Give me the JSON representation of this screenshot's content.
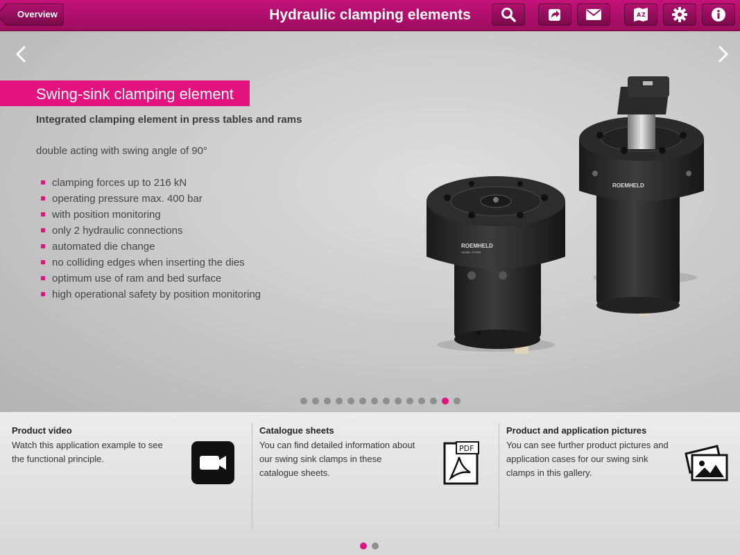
{
  "header": {
    "back_label": "Overview",
    "title": "Hydraulic clamping elements",
    "buttons": [
      "search-icon",
      "share-icon",
      "mail-icon",
      "language-icon",
      "gear-icon",
      "info-icon"
    ]
  },
  "slide": {
    "title": "Swing-sink clamping element",
    "subtitle": "Integrated clamping element in press tables and rams",
    "description": "double acting with swing angle of 90°",
    "bullets": [
      "clamping forces up to 216 kN",
      "operating pressure max. 400 bar",
      "with position monitoring",
      "only 2 hydraulic connections",
      "automated die change",
      "no colliding edges when inserting the dies",
      "optimum use of ram and bed surface",
      "high operational safety by position monitoring"
    ],
    "product_brand": "ROEMHELD",
    "product_subbrand": "HILMA • STARK",
    "pager_total": 14,
    "pager_active": 12,
    "accent_color": "#e2137f"
  },
  "cards": [
    {
      "title": "Product video",
      "text_lines": [
        "Watch this application example to see",
        "the functional principle."
      ],
      "icon": "video-camera-icon"
    },
    {
      "title": "Catalogue sheets",
      "text_lines": [
        "You can find detailed information about",
        "our swing sink clamps in these",
        "catalogue sheets."
      ],
      "icon": "pdf-document-icon",
      "icon_label": "PDF"
    },
    {
      "title": "Product and application pictures",
      "text_lines": [
        "You can see further product pictures and",
        "application cases for our swing sink",
        "clamps in this gallery."
      ],
      "icon": "picture-gallery-icon"
    }
  ],
  "panel_pager": {
    "total": 2,
    "active": 1
  }
}
